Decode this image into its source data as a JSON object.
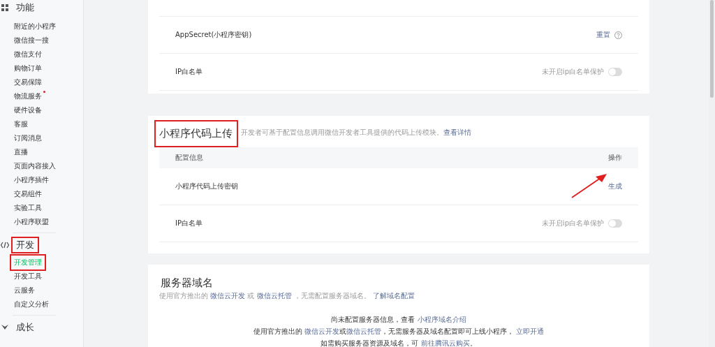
{
  "sidebar": {
    "groups": [
      {
        "title": "功能",
        "annotated": false,
        "items": [
          {
            "label": "附近的小程序",
            "selected": false,
            "dot": false,
            "annotated": false
          },
          {
            "label": "微信搜一搜",
            "selected": false,
            "dot": false,
            "annotated": false
          },
          {
            "label": "微信支付",
            "selected": false,
            "dot": false,
            "annotated": false
          },
          {
            "label": "购物订单",
            "selected": false,
            "dot": false,
            "annotated": false
          },
          {
            "label": "交易保障",
            "selected": false,
            "dot": false,
            "annotated": false
          },
          {
            "label": "物流服务",
            "selected": false,
            "dot": true,
            "annotated": false
          },
          {
            "label": "硬件设备",
            "selected": false,
            "dot": false,
            "annotated": false
          },
          {
            "label": "客服",
            "selected": false,
            "dot": false,
            "annotated": false
          },
          {
            "label": "订阅消息",
            "selected": false,
            "dot": false,
            "annotated": false
          },
          {
            "label": "直播",
            "selected": false,
            "dot": false,
            "annotated": false
          },
          {
            "label": "页面内容接入",
            "selected": false,
            "dot": false,
            "annotated": false
          },
          {
            "label": "小程序插件",
            "selected": false,
            "dot": false,
            "annotated": false
          },
          {
            "label": "交易组件",
            "selected": false,
            "dot": false,
            "annotated": false
          },
          {
            "label": "实验工具",
            "selected": false,
            "dot": false,
            "annotated": false
          },
          {
            "label": "小程序联盟",
            "selected": false,
            "dot": false,
            "annotated": false
          }
        ]
      },
      {
        "title": "开发",
        "annotated": true,
        "items": [
          {
            "label": "开发管理",
            "selected": true,
            "dot": false,
            "annotated": true
          },
          {
            "label": "开发工具",
            "selected": false,
            "dot": false,
            "annotated": false
          },
          {
            "label": "云服务",
            "selected": false,
            "dot": false,
            "annotated": false
          },
          {
            "label": "自定义分析",
            "selected": false,
            "dot": false,
            "annotated": false
          }
        ]
      },
      {
        "title": "成长",
        "annotated": false
      }
    ]
  },
  "cards": [
    {
      "kind": "table",
      "rows": [
        {
          "kind": "action",
          "label": "AppSecret(小程序密钥)",
          "action": "重置",
          "help": true,
          "arrow": false
        },
        {
          "kind": "toggle",
          "label": "IP白名单",
          "status": "未开启ip白名单保护",
          "on": false
        }
      ]
    },
    {
      "kind": "table",
      "title": "小程序代码上传",
      "title_annotated": true,
      "description": [
        {
          "text": "开发者可基于配置信息调用微信开发者工具提供的代码上传模块。",
          "link": false
        },
        {
          "text": "查看详情",
          "link": true
        }
      ],
      "header": [
        "配置信息",
        "操作"
      ],
      "rows": [
        {
          "kind": "action",
          "label": "小程序代码上传密钥",
          "action": "生成",
          "help": false,
          "arrow": true
        },
        {
          "kind": "toggle",
          "label": "IP白名单",
          "status": "未开启ip白名单保护",
          "on": false
        }
      ]
    },
    {
      "kind": "notice",
      "title": "服务器域名",
      "title_annotated": false,
      "description": [
        {
          "text": "使用官方推出的 ",
          "link": false
        },
        {
          "text": "微信云开发",
          "link": true
        },
        {
          "text": " 或 ",
          "link": false
        },
        {
          "text": "微信云托管",
          "link": true
        },
        {
          "text": " ，无需配置服务器域名。 ",
          "link": false
        },
        {
          "text": "了解域名配置",
          "link": true
        }
      ],
      "lines": [
        [
          {
            "text": "尚未配置服务器信息，查看 ",
            "link": false
          },
          {
            "text": "小程序域名介绍",
            "link": true
          }
        ],
        [
          {
            "text": "使用官方推出的 ",
            "link": false
          },
          {
            "text": "微信云开发",
            "link": true
          },
          {
            "text": "或",
            "link": false
          },
          {
            "text": "微信云托管",
            "link": true
          },
          {
            "text": "，无需服务器及域名配置即可上线小程序，  ",
            "link": false
          },
          {
            "text": "立即开通",
            "link": true
          }
        ],
        [
          {
            "text": "如需购买服务器资源及域名，可 ",
            "link": false
          },
          {
            "text": "前往腾讯云购买",
            "link": true
          },
          {
            "text": "。",
            "link": false
          }
        ]
      ]
    }
  ]
}
